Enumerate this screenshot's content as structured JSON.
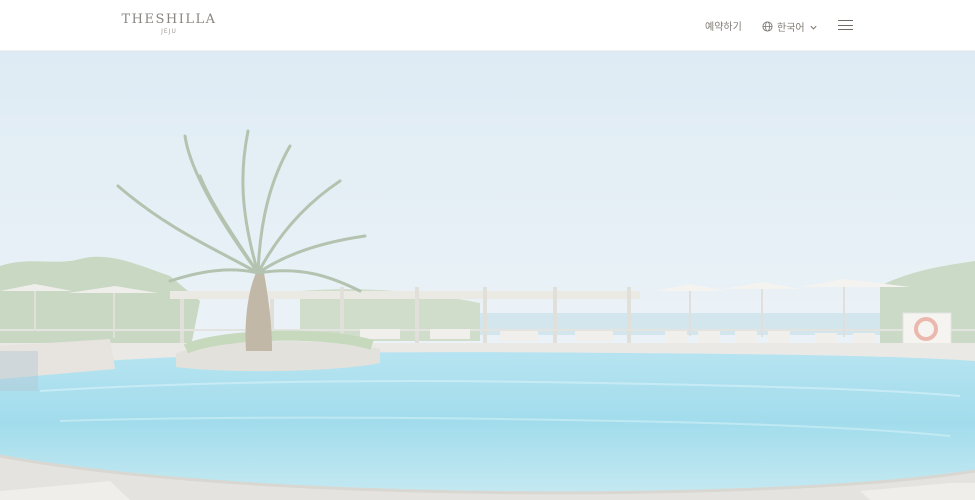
{
  "header": {
    "logo_text": "THESHILLA",
    "logo_sub": "JEJU",
    "book_label": "예약하기",
    "language_label": "한국어",
    "icons": {
      "language": "globe-icon",
      "dropdown": "chevron-down-icon",
      "menu": "hamburger-menu-icon"
    }
  },
  "hero": {
    "scene": "resort-pool-with-palm-tree"
  },
  "colors": {
    "sky": "#dfeaf2",
    "pool": "#8fd3e6",
    "text_muted": "#7f7a73"
  }
}
